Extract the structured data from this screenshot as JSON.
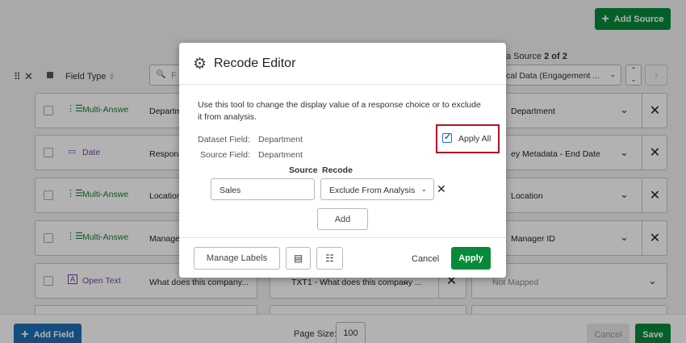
{
  "top": {
    "add_source_label": "Add Source",
    "source_counter_prefix": "a Source",
    "source_counter_value": "2 of 2",
    "source_select_value": "cal Data (Engagement ..."
  },
  "header": {
    "field_type_label": "Field Type",
    "search_placeholder": "F"
  },
  "rows": [
    {
      "type_label": "Multi-Answe",
      "field": "Departm",
      "mapped": "Department"
    },
    {
      "type_label": "Date",
      "field": "Respons",
      "mapped": "ey Metadata - End Date"
    },
    {
      "type_label": "Multi-Answe",
      "field": "Location",
      "mapped": "Location"
    },
    {
      "type_label": "Multi-Answe",
      "field": "Manage",
      "mapped": "Manager ID"
    },
    {
      "type_label": "Open Text",
      "field": "What does this company...",
      "mid": "TXT1 - What does this company ...",
      "mapped": "Not Mapped"
    }
  ],
  "footer": {
    "add_field_label": "Add Field",
    "page_size_label": "Page Size:",
    "page_size_value": "100",
    "cancel_label": "Cancel",
    "save_label": "Save"
  },
  "modal": {
    "title": "Recode Editor",
    "description": "Use this tool to change the display value of a response choice or to exclude it from analysis.",
    "dataset_field_label": "Dataset Field:",
    "dataset_field_value": "Department",
    "source_field_label": "Source Field:",
    "source_field_value": "Department",
    "apply_all_label": "Apply All",
    "col_source": "Source",
    "col_recode": "Recode",
    "source_value": "Sales",
    "recode_value": "Exclude From Analysis",
    "add_label": "Add",
    "manage_labels": "Manage Labels",
    "cancel_label": "Cancel",
    "apply_label": "Apply"
  },
  "colors": {
    "brand_green": "#078a3a",
    "highlight_red": "#b0122a",
    "check_blue": "#1f6fb5"
  }
}
